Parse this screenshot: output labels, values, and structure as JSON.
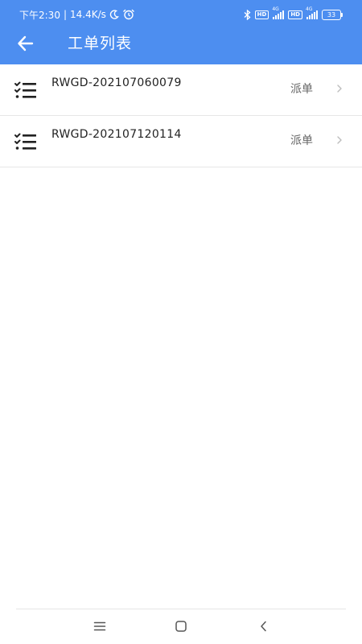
{
  "status_bar": {
    "time": "下午2:30",
    "separator": "|",
    "net_speed": "14.4K/s",
    "hd1": "HD",
    "net1": "4G",
    "hd2": "HD",
    "net2": "4G",
    "battery": "33"
  },
  "header": {
    "title": "工单列表",
    "background_color": "#4d8ef0"
  },
  "work_orders": [
    {
      "id": "RWGD-202107060079",
      "status": "派单",
      "icon": "checklist-icon"
    },
    {
      "id": "RWGD-202107120114",
      "status": "派单",
      "icon": "checklist-icon"
    }
  ]
}
